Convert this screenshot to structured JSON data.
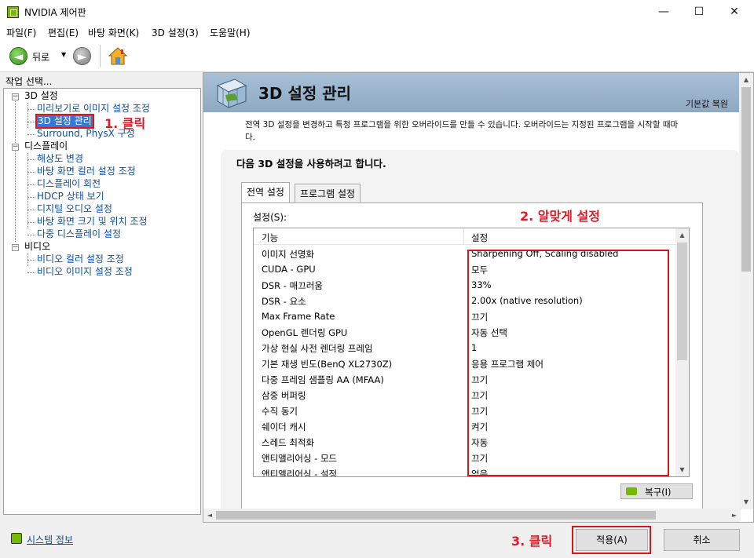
{
  "window": {
    "title": "NVIDIA 제어판",
    "minimize": "—",
    "maximize": "☐",
    "close": "✕"
  },
  "menu": [
    "파일(F)",
    "편집(E)",
    "바탕 화면(K)",
    "3D 설정(3)",
    "도움말(H)"
  ],
  "toolbar": {
    "back_label": "뒤로",
    "dropdown": "▼",
    "back_arrow": "◄",
    "forward_arrow": "►"
  },
  "tasks": {
    "title": "작업 선택...",
    "categories": [
      {
        "label": "3D 설정",
        "items": [
          "미리보기로 이미지 설정 조정",
          "3D 설정 관리",
          "Surround, PhysX 구성"
        ]
      },
      {
        "label": "디스플레이",
        "items": [
          "해상도 변경",
          "바탕 화면 컬러 설정 조정",
          "디스플레이 회전",
          "HDCP 상태 보기",
          "디지털 오디오 설정",
          "바탕 화면 크기 및 위치 조정",
          "다중 디스플레이 설정"
        ]
      },
      {
        "label": "비디오",
        "items": [
          "비디오 컬러 설정 조정",
          "비디오 이미지 설정 조정"
        ]
      }
    ],
    "expander": "−"
  },
  "annotations": {
    "step1": "1. 클릭",
    "step2": "2. 알맞게 설정",
    "step3": "3. 클릭"
  },
  "page": {
    "title": "3D 설정 관리",
    "restore_defaults": "기본값 복원",
    "description": "전역 3D 설정을 변경하고 특정 프로그램을 위한 오버라이드를 만들 수 있습니다. 오버라이드는 지정된 프로그램을 시작할 때마",
    "description_cont": "다.",
    "section_title": "다음 3D 설정을 사용하려고 합니다.",
    "tabs": [
      "전역 설정",
      "프로그램 설정"
    ],
    "settings_label": "설정(S):",
    "columns": [
      "기능",
      "설정"
    ],
    "rows": [
      {
        "feature": "이미지 선명화",
        "value": "Sharpening Off, Scaling disabled"
      },
      {
        "feature": "CUDA - GPU",
        "value": "모두"
      },
      {
        "feature": "DSR - 매끄러움",
        "value": "33%"
      },
      {
        "feature": "DSR - 요소",
        "value": "2.00x (native resolution)"
      },
      {
        "feature": "Max Frame Rate",
        "value": "끄기"
      },
      {
        "feature": "OpenGL 렌더링 GPU",
        "value": "자동 선택"
      },
      {
        "feature": "가상 현실 사전 렌더링 프레임",
        "value": "1"
      },
      {
        "feature": "기본 재생 빈도(BenQ XL2730Z)",
        "value": "응용 프로그램 제어"
      },
      {
        "feature": "다중 프레임 샘플링 AA (MFAA)",
        "value": "끄기"
      },
      {
        "feature": "삼중 버퍼링",
        "value": "끄기"
      },
      {
        "feature": "수직 동기",
        "value": "끄기"
      },
      {
        "feature": "쉐이더 캐시",
        "value": "켜기"
      },
      {
        "feature": "스레드 최적화",
        "value": "자동"
      },
      {
        "feature": "앤티앨리어싱 - 모드",
        "value": "끄기"
      },
      {
        "feature": "앤티앨리어싱 - 설정",
        "value": "없음"
      }
    ],
    "restore_button": "복구(I)"
  },
  "bottom": {
    "system_info": "시스템 정보",
    "apply": "적용(A)",
    "cancel": "취소"
  },
  "colors": {
    "accent_red": "#e01b24",
    "nvidia_green": "#76b900",
    "link_blue": "#0b4f9e"
  }
}
